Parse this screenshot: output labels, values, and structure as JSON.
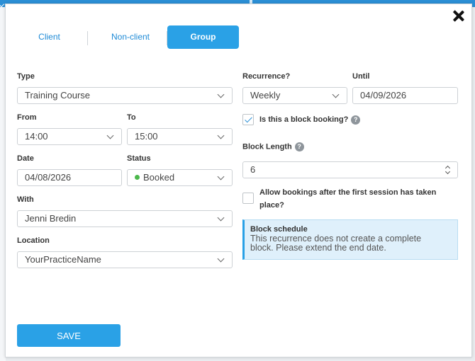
{
  "tabs": {
    "client": "Client",
    "nonclient": "Non-client",
    "group": "Group"
  },
  "form": {
    "type": {
      "label": "Type",
      "value": "Training Course"
    },
    "from": {
      "label": "From",
      "value": "14:00"
    },
    "to": {
      "label": "To",
      "value": "15:00"
    },
    "date": {
      "label": "Date",
      "value": "04/08/2026"
    },
    "status": {
      "label": "Status",
      "value": "Booked",
      "dot_color": "#4cb84c"
    },
    "with": {
      "label": "With",
      "value": "Jenni Bredin"
    },
    "location": {
      "label": "Location",
      "value": "YourPracticeName"
    },
    "recurrence": {
      "label": "Recurrence?",
      "value": "Weekly"
    },
    "until": {
      "label": "Until",
      "value": "04/09/2026"
    },
    "block_booking": {
      "label": "Is this a block booking?",
      "checked": true
    },
    "block_length": {
      "label": "Block Length",
      "value": "6"
    },
    "allow_bookings": {
      "label_line1": "Allow bookings after the first session has taken",
      "label_line2": "place?",
      "checked": false
    },
    "help_glyph": "?"
  },
  "block_schedule": {
    "title": "Block schedule",
    "line1": "This recurrence does not create a complete",
    "line2": "block. Please extend the end date."
  },
  "save_label": "SAVE",
  "colors": {
    "accent": "#2aa1e6",
    "info_bg": "#dff0fb"
  }
}
